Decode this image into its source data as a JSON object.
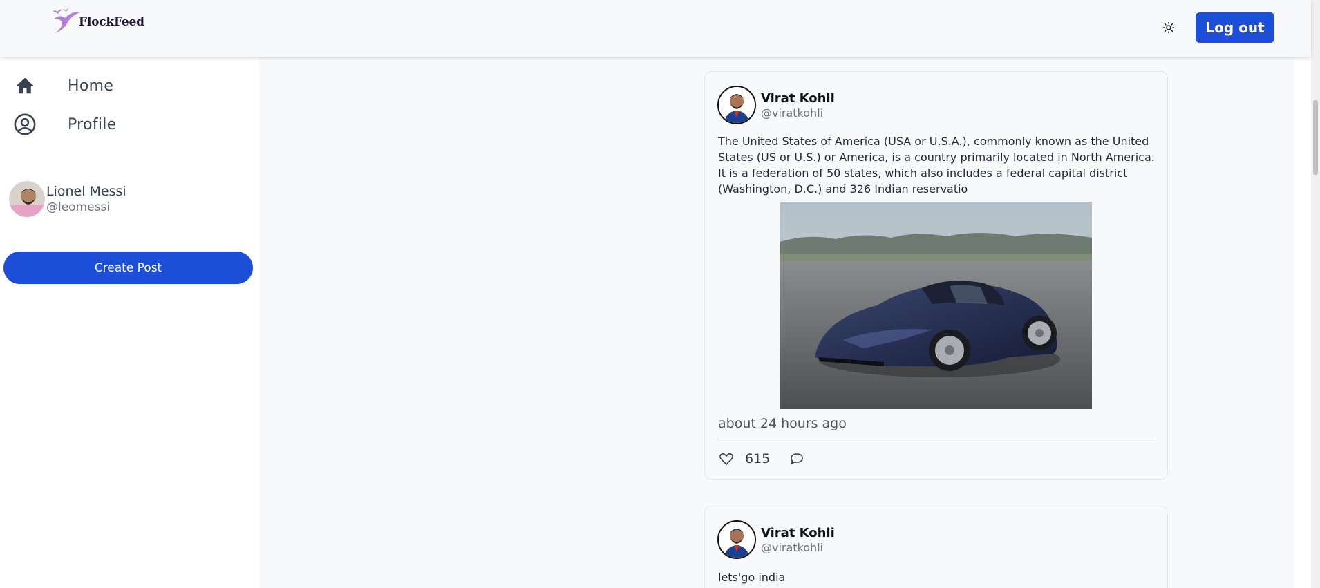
{
  "brand": {
    "name": "FlockFeed",
    "logo_icon": "birds-logo-icon"
  },
  "header": {
    "theme_toggle_icon": "sun-icon",
    "logout_label": "Log out"
  },
  "sidebar": {
    "nav": [
      {
        "label": "Home",
        "icon": "home-icon"
      },
      {
        "label": "Profile",
        "icon": "user-circle-icon"
      }
    ],
    "user": {
      "name": "Lionel Messi",
      "handle": "@leomessi"
    },
    "create_post_label": "Create Post"
  },
  "feed": {
    "posts": [
      {
        "author_name": "Virat Kohli",
        "author_handle": "@viratkohli",
        "text": "The United States of America (USA or U.S.A.), commonly known as the United States (US or U.S.) or America, is a country primarily located in North America. It is a federation of 50 states, which also includes a federal capital district (Washington, D.C.) and 326 Indian reservatio",
        "image": "blue-sports-car-photo",
        "time": "about 24 hours ago",
        "likes": "615"
      },
      {
        "author_name": "Virat Kohli",
        "author_handle": "@viratkohli",
        "text": "lets'go india"
      }
    ]
  },
  "colors": {
    "primary": "#1d4ed8",
    "background": "#f8f9fb",
    "logo_purple": "#b57edc"
  }
}
